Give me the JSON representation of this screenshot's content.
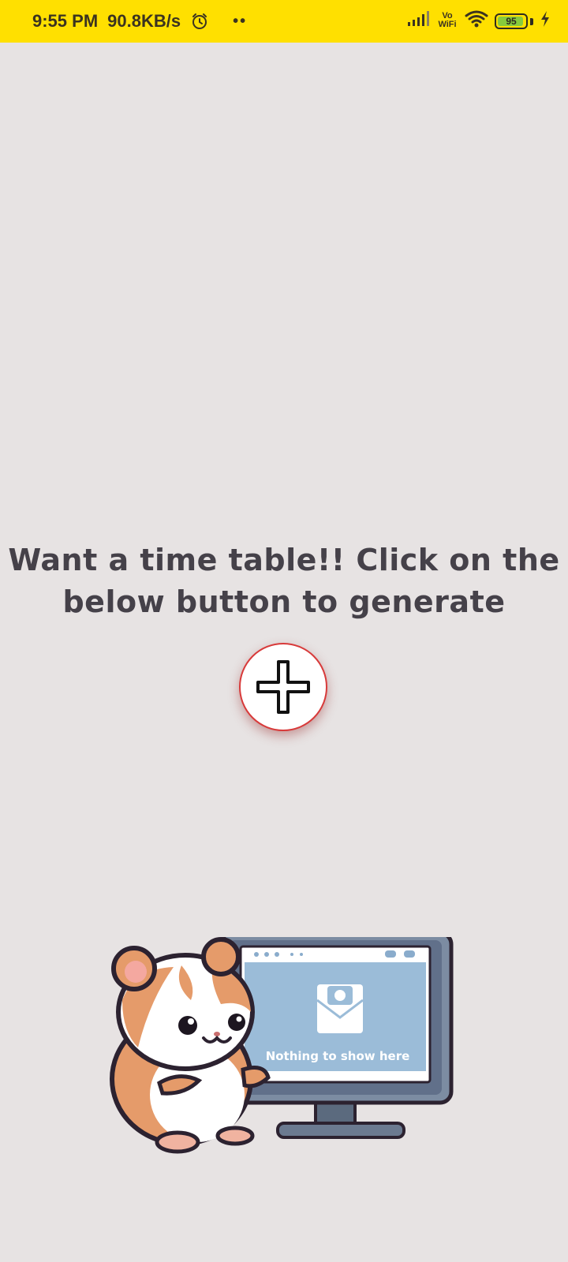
{
  "status_bar": {
    "time": "9:55 PM",
    "speed": "90.8KB/s",
    "alarm_icon": "alarm-clock-icon",
    "more_dots": "••",
    "signal_icon": "cellular-signal-icon",
    "vowifi_label": "Vo WiFi",
    "wifi_icon": "wifi-icon",
    "battery_level": "95",
    "charging_icon": "lightning-bolt-icon",
    "bg_color": "#ffe000"
  },
  "main": {
    "prompt_line1": "Want a time table!! Click on the",
    "prompt_line2": "below button to generate",
    "add_button_icon": "plus-icon",
    "add_button_border_color": "#d83a3a"
  },
  "illustration": {
    "screen_text": "Nothing to show here"
  },
  "colors": {
    "background": "#e7e3e3",
    "text": "#454149"
  }
}
